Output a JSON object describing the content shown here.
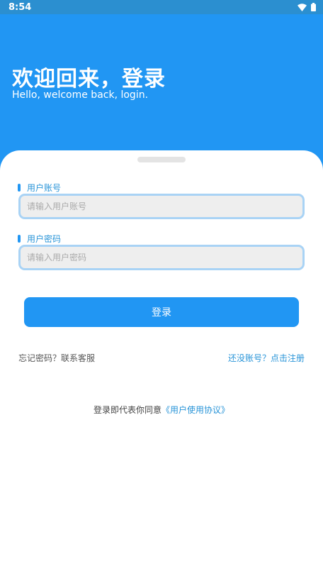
{
  "status_bar": {
    "time": "8:54",
    "icons": [
      "wifi-icon",
      "battery-icon"
    ]
  },
  "header": {
    "title": "欢迎回来，登录",
    "subtitle": "Hello, welcome back, login."
  },
  "form": {
    "username": {
      "label": "用户账号",
      "placeholder": "请输入用户账号",
      "value": ""
    },
    "password": {
      "label": "用户密码",
      "placeholder": "请输入用户密码",
      "value": ""
    },
    "login_label": "登录"
  },
  "links": {
    "forgot": "忘记密码？联系客服",
    "register": "还没账号？点击注册"
  },
  "agreement": {
    "prefix": "登录即代表你同意",
    "link": "《用户使用协议》"
  },
  "colors": {
    "primary": "#2196f3",
    "status_bar": "#2b8fd0",
    "link": "#2a95d8",
    "input_border": "#a9d3f5",
    "input_bg": "#eeeeee"
  }
}
